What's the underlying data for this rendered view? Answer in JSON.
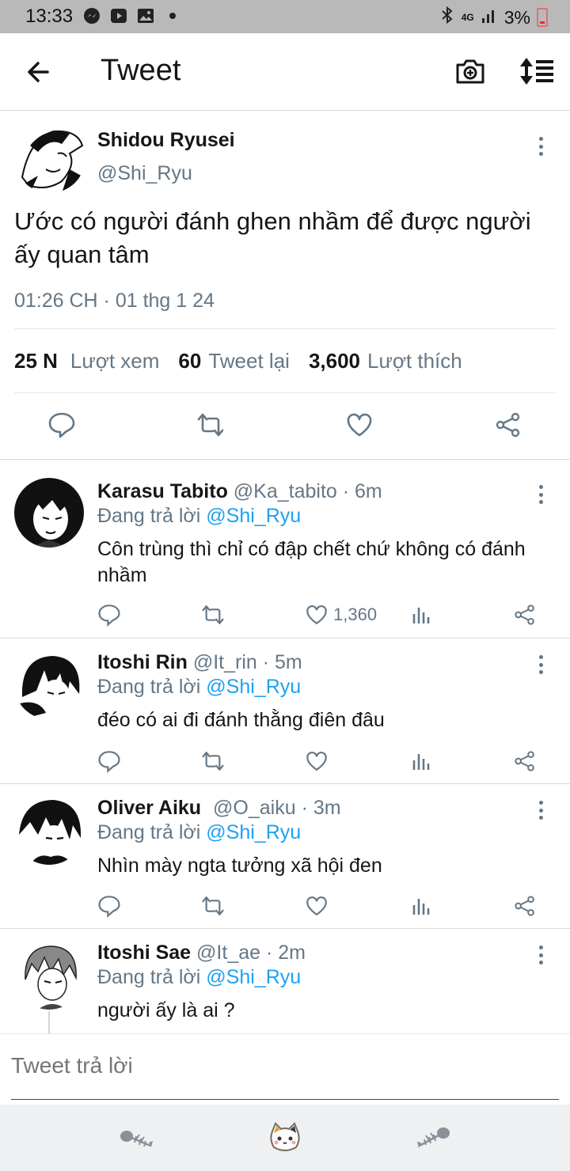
{
  "status_bar": {
    "time": "13:33",
    "network": "4G",
    "battery": "3%"
  },
  "header": {
    "title": "Tweet",
    "back_icon": "arrow-left-icon",
    "camera_icon": "camera-add-icon",
    "sort_icon": "sort-icon"
  },
  "main_tweet": {
    "name": "Shidou Ryusei",
    "handle": "@Shi_Ryu",
    "text": "Ước có người đánh ghen nhầm để được người ấy quan tâm",
    "timestamp": "01:26 CH · 01 thg 1 24",
    "views_count": "25 N",
    "views_label": "Lượt xem",
    "retweets_count": "60",
    "retweets_label": "Tweet lại",
    "likes_count": "3,600",
    "likes_label": "Lượt thích"
  },
  "replies": [
    {
      "name": "Karasu Tabito",
      "handle_time": "@Ka_tabito · 6m",
      "replying_prefix": "Đang trả lời",
      "replying_to": "@Shi_Ryu",
      "text": "Côn trùng thì chỉ có đập chết chứ không có đánh nhầm",
      "likes": "1,360"
    },
    {
      "name": "Itoshi Rin",
      "handle_time": "@It_rin · 5m",
      "replying_prefix": "Đang trả lời",
      "replying_to": "@Shi_Ryu",
      "text": "đéo có ai đi đánh thằng điên đâu",
      "likes": ""
    },
    {
      "name": "Oliver Aiku",
      "handle_time": "@O_aiku · 3m",
      "replying_prefix": "Đang trả lời",
      "replying_to": "@Shi_Ryu",
      "text": "Nhìn mày ngta tưởng xã hội đen",
      "likes": ""
    },
    {
      "name": "Itoshi Sae",
      "handle_time": "@It_ae · 2m",
      "replying_prefix": "Đang trả lời",
      "replying_to": "@Shi_Ryu",
      "text": "người ấy là ai ?",
      "likes": ""
    }
  ],
  "compose": {
    "placeholder": "Tweet trả lời"
  },
  "colors": {
    "accent": "#1da1f2",
    "secondary_text": "#657786",
    "primary_text": "#14171a",
    "status_bar_bg": "#b9b9b9"
  }
}
